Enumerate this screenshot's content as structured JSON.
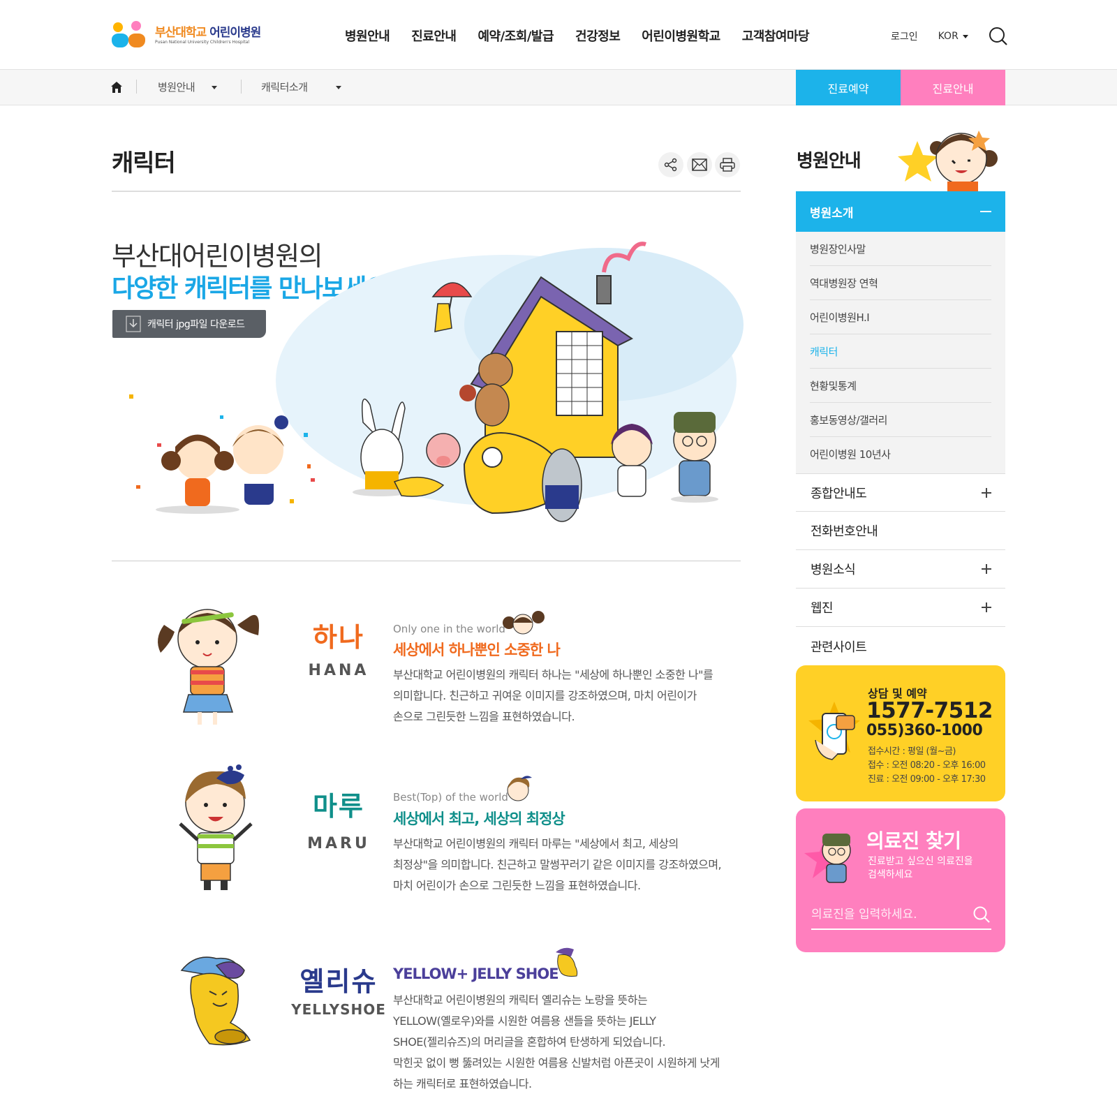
{
  "brand": {
    "name_ko_1": "부산대학교",
    "name_ko_2": "어린이병원",
    "name_en": "Pusan National University Children's Hospital"
  },
  "gnb": [
    "병원안내",
    "진료안내",
    "예약/조회/발급",
    "건강정보",
    "어린이병원학교",
    "고객참여마당"
  ],
  "util": {
    "login": "로그인",
    "lang": "KOR"
  },
  "location": {
    "depth1": "병원안내",
    "depth2": "캐릭터소개"
  },
  "quick": {
    "reserve": "진료예약",
    "guide": "진료안내"
  },
  "page": {
    "title": "캐릭터"
  },
  "intro": {
    "line1": "부산대어린이병원의",
    "line2": "다양한 캐릭터를 만나보세요.",
    "download": "캐릭터 jpg파일 다운로드"
  },
  "characters": [
    {
      "name": "하나",
      "name_en": "HANA",
      "tagline": "Only one in the world",
      "title": "세상에서 하나뿐인 소중한 나",
      "desc": [
        "부산대학교 어린이병원의 캐릭터 하나는 \"세상에 하나뿐인 소중한 나\"를",
        "의미합니다. 친근하고 귀여운 이미지를 강조하였으며, 마치 어린이가",
        "손으로 그린듯한 느낌을 표현하였습니다."
      ],
      "color": "#f06a1e"
    },
    {
      "name": "마루",
      "name_en": "MARU",
      "tagline": "Best(Top) of the world",
      "title": "세상에서 최고, 세상의 최정상",
      "desc": [
        "부산대학교 어린이병원의 캐릭터 마루는 \"세상에서 최고, 세상의",
        "최정상\"을 의미합니다. 친근하고 말썽꾸러기 같은 이미지를 강조하였으며,",
        "마치 어린이가 손으로 그린듯한 느낌을 표현하였습니다."
      ],
      "color": "#0f8f8a"
    },
    {
      "name": "옐리슈",
      "name_en": "YELLYSHOE",
      "title": "YELLOW+ JELLY SHOE",
      "desc": [
        "부산대학교 어린이병원의 캐릭터 옐리슈는 노랑을 뜻하는",
        "YELLOW(옐로우)와를 시원한 여름용 샌들을 뜻하는 JELLY",
        "SHOE(젤리슈즈)의 머리글을 혼합하여 탄생하게 되었습니다.",
        "막힌곳 없이 뻥 뚫려있는 시원한 여름용 신발처럼 아픈곳이 시원하게 낫게",
        "하는 캐릭터로 표현하였습니다."
      ],
      "color": "#4b3f9a"
    }
  ],
  "sidebar": {
    "title": "병원안내",
    "active": "병원소개",
    "sub": [
      "병원장인사말",
      "역대병원장 연혁",
      "어린이병원H.I",
      "캐릭터",
      "현황및통계",
      "홍보동영상/갤러리",
      "어린이병원 10년사"
    ],
    "items": [
      "종합안내도",
      "전화번호안내",
      "병원소식",
      "웹진",
      "관련사이트"
    ]
  },
  "contact": {
    "label": "상담 및 예약",
    "phone1": "1577-7512",
    "phone2": "055)360-1000",
    "hours": [
      "접수시간 : 평일 (월~금)",
      "접수 : 오전 08:20 - 오후 16:00",
      "진료 : 오전 09:00 - 오후 17:30"
    ]
  },
  "doctor_search": {
    "title": "의료진 찾기",
    "desc1": "진료받고 싶으신 의료진을",
    "desc2": "검색하세요",
    "placeholder": "의료진을 입력하세요."
  },
  "colors": {
    "blue": "#1cb3ea",
    "pink": "#ff7fbe",
    "yellow": "#ffd026",
    "orange": "#f06a1e"
  }
}
